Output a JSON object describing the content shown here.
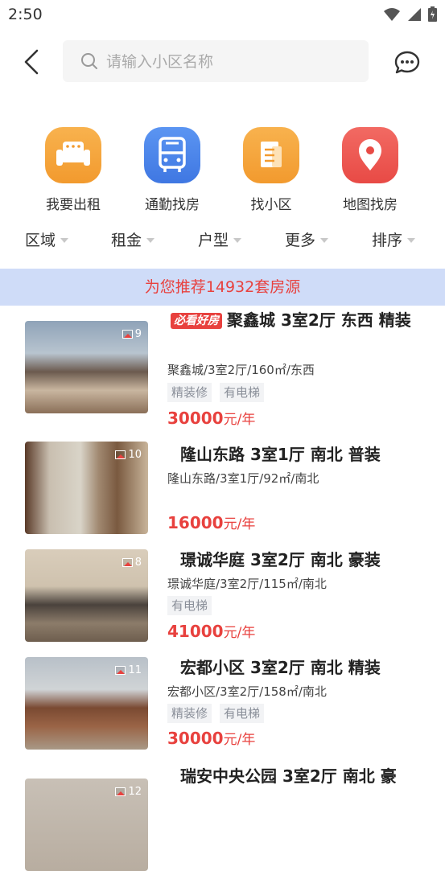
{
  "status": {
    "time": "2:50"
  },
  "search": {
    "placeholder": "请输入小区名称"
  },
  "quick_actions": [
    {
      "label": "我要出租",
      "icon": "sofa-icon",
      "color": "#f5a23a"
    },
    {
      "label": "通勤找房",
      "icon": "bus-icon",
      "color": "#4a86ee"
    },
    {
      "label": "找小区",
      "icon": "building-icon",
      "color": "#f5a23a"
    },
    {
      "label": "地图找房",
      "icon": "map-pin-icon",
      "color": "#ee5050"
    }
  ],
  "filters": [
    {
      "label": "区域"
    },
    {
      "label": "租金"
    },
    {
      "label": "户型"
    },
    {
      "label": "更多"
    },
    {
      "label": "排序"
    }
  ],
  "banner": {
    "text": "为您推荐14932套房源"
  },
  "listings": [
    {
      "badge": "必看好房",
      "title": "聚鑫城 3室2厅 东西 精装",
      "subtitle": "聚鑫城/3室2厅/160㎡/东西",
      "tags": [
        "精装修",
        "有电梯"
      ],
      "price": "30000",
      "unit": "元/年",
      "photo_count": "9"
    },
    {
      "badge": "",
      "title": "隆山东路 3室1厅 南北 普装",
      "subtitle": "隆山东路/3室1厅/92㎡/南北",
      "tags": [],
      "price": "16000",
      "unit": "元/年",
      "photo_count": "10"
    },
    {
      "badge": "",
      "title": "璟诚华庭 3室2厅 南北 豪装",
      "subtitle": "璟诚华庭/3室2厅/115㎡/南北",
      "tags": [
        "有电梯"
      ],
      "price": "41000",
      "unit": "元/年",
      "photo_count": "8"
    },
    {
      "badge": "",
      "title": "宏都小区 3室2厅 南北 精装",
      "subtitle": "宏都小区/3室2厅/158㎡/南北",
      "tags": [
        "精装修",
        "有电梯"
      ],
      "price": "30000",
      "unit": "元/年",
      "photo_count": "11"
    },
    {
      "badge": "",
      "title": "瑞安中央公园 3室2厅 南北 豪",
      "subtitle": "",
      "tags": [],
      "price": "",
      "unit": "",
      "photo_count": "12"
    }
  ]
}
